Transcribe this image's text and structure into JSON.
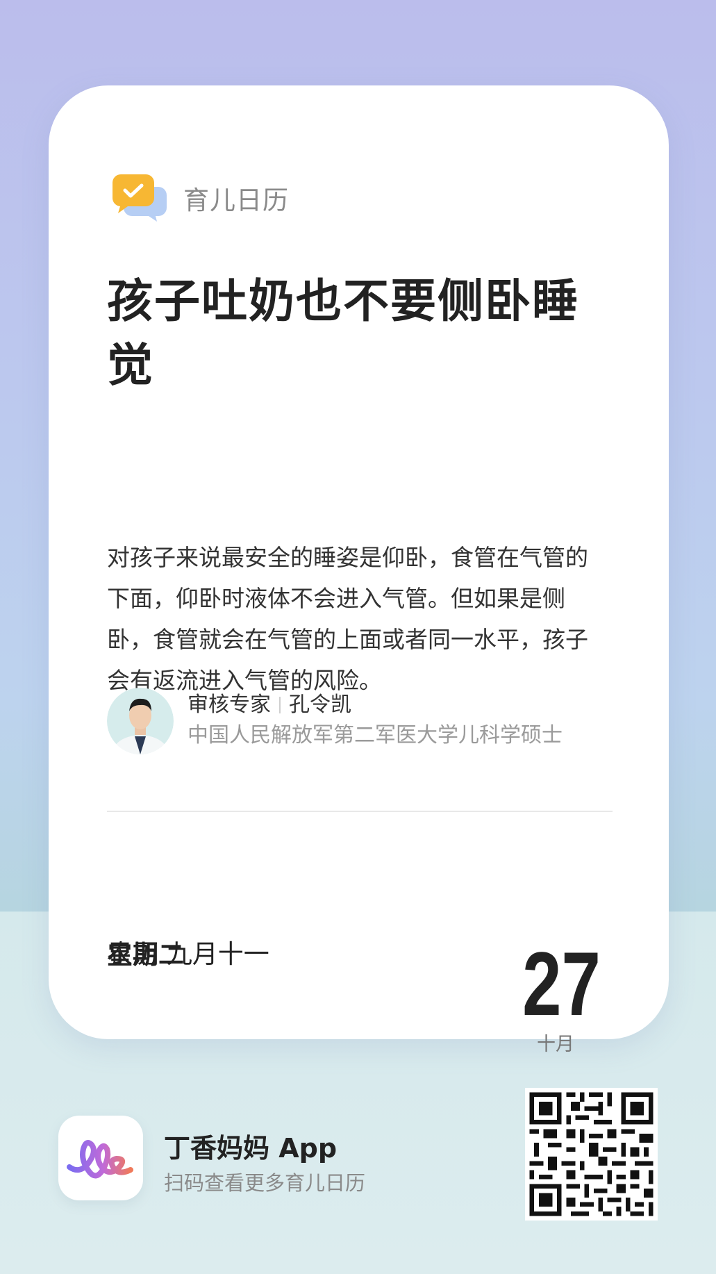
{
  "brand": {
    "name": "育儿日历",
    "logo_icon": "check-chat-bubble-icon"
  },
  "article": {
    "title": "孩子吐奶也不要侧卧睡觉",
    "body": "对孩子来说最安全的睡姿是仰卧，食管在气管的下面，仰卧时液体不会进入气管。但如果是侧卧，食管就会在气管的上面或者同一水平，孩子会有返流进入气管的风险。"
  },
  "reviewer": {
    "role": "审核专家",
    "name": "孔令凯",
    "credential": "中国人民解放军第二军医大学儿科学硕士"
  },
  "date": {
    "weekday": "星期二",
    "lunar": "农历 九月十一",
    "day": "27",
    "month": "十月"
  },
  "footer": {
    "app_name": "丁香妈妈 App",
    "subtitle": "扫码查看更多育儿日历",
    "app_icon": "dxmm-logo-icon",
    "qr_icon": "qr-code-icon"
  },
  "colors": {
    "bg_top": "#bbbdec",
    "bg_bottom": "#dcecee",
    "accent_yellow": "#f7b733",
    "bubble_blue": "#a9c6f2"
  }
}
